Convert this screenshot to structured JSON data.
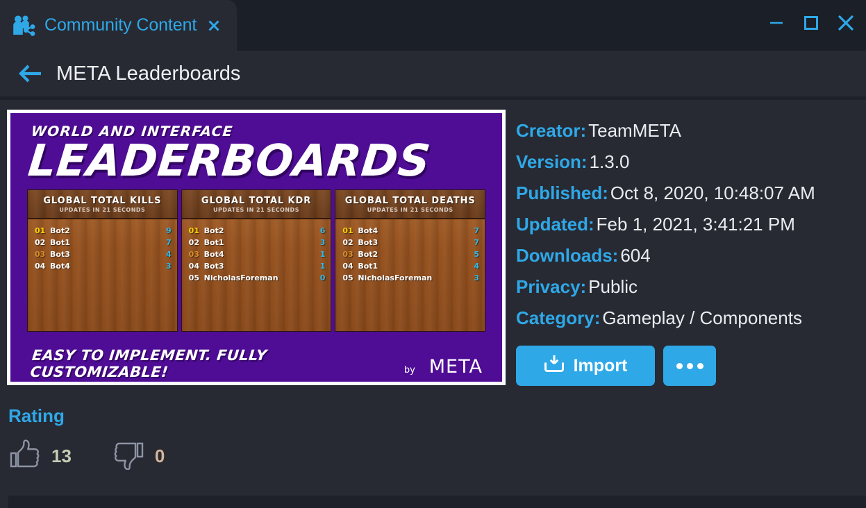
{
  "window": {
    "tab": {
      "title": "Community Content",
      "icon": "people-share-icon",
      "close_icon": "close-icon"
    },
    "controls": {
      "minimize": "minimize-icon",
      "maximize": "maximize-icon",
      "close": "close-icon"
    }
  },
  "header": {
    "back_icon": "arrow-left-icon",
    "title": "META Leaderboards"
  },
  "thumbnail": {
    "eyebrow": "WORLD AND INTERFACE",
    "title": "LEADERBOARDS",
    "footer_text": "EASY TO IMPLEMENT. FULLY CUSTOMIZABLE!",
    "brand_by": "by",
    "brand_name": "META",
    "bg_color": "#4f0d96",
    "boards": [
      {
        "title": "GLOBAL TOTAL KILLS",
        "subtitle": "UPDATES IN 21 SECONDS",
        "rows": [
          {
            "rank": "01",
            "name": "Bot2",
            "score": "9"
          },
          {
            "rank": "02",
            "name": "Bot1",
            "score": "7"
          },
          {
            "rank": "03",
            "name": "Bot3",
            "score": "4"
          },
          {
            "rank": "04",
            "name": "Bot4",
            "score": "3"
          }
        ]
      },
      {
        "title": "GLOBAL TOTAL KDR",
        "subtitle": "UPDATES IN 21 SECONDS",
        "rows": [
          {
            "rank": "01",
            "name": "Bot2",
            "score": "6"
          },
          {
            "rank": "02",
            "name": "Bot1",
            "score": "3"
          },
          {
            "rank": "03",
            "name": "Bot4",
            "score": "1"
          },
          {
            "rank": "04",
            "name": "Bot3",
            "score": "1"
          },
          {
            "rank": "05",
            "name": "NicholasForeman",
            "score": "0"
          }
        ]
      },
      {
        "title": "GLOBAL TOTAL DEATHS",
        "subtitle": "UPDATES IN 21 SECONDS",
        "rows": [
          {
            "rank": "01",
            "name": "Bot4",
            "score": "7"
          },
          {
            "rank": "02",
            "name": "Bot3",
            "score": "7"
          },
          {
            "rank": "03",
            "name": "Bot2",
            "score": "5"
          },
          {
            "rank": "04",
            "name": "Bot1",
            "score": "4"
          },
          {
            "rank": "05",
            "name": "NicholasForeman",
            "score": "3"
          }
        ]
      }
    ]
  },
  "details": {
    "creator_label": "Creator:",
    "creator_value": "TeamMETA",
    "version_label": "Version:",
    "version_value": "1.3.0",
    "published_label": "Published:",
    "published_value": "Oct 8, 2020, 10:48:07 AM",
    "updated_label": "Updated:",
    "updated_value": "Feb 1, 2021, 3:41:21 PM",
    "downloads_label": "Downloads:",
    "downloads_value": "604",
    "privacy_label": "Privacy:",
    "privacy_value": "Public",
    "category_label": "Category:",
    "category_value": "Gameplay / Components"
  },
  "actions": {
    "import_label": "Import",
    "import_icon": "import-tray-icon",
    "more_icon": "ellipsis-icon"
  },
  "rating": {
    "title": "Rating",
    "up_icon": "thumbs-up-icon",
    "up_count": "13",
    "down_icon": "thumbs-down-icon",
    "down_count": "0"
  },
  "colors": {
    "accent": "#2fa8e8",
    "titlebar_bg": "#1b1f27",
    "content_bg": "#272a33",
    "text": "#e9ecef",
    "thumb_purple": "#4f0d96",
    "board_wood": "#96521f",
    "score_cyan": "#33b9e8",
    "rank_gold": "#ffd500",
    "rank_bronze": "#d98f2a",
    "up_count": "#c3cdb4",
    "down_count": "#d3b49a"
  }
}
